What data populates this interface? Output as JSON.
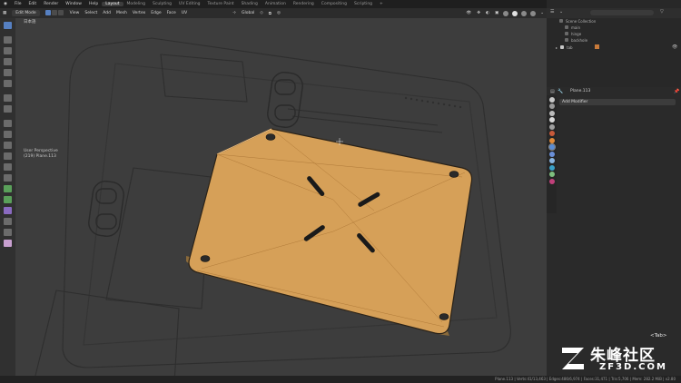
{
  "menu": {
    "items": [
      "File",
      "Edit",
      "Render",
      "Window",
      "Help"
    ],
    "workspaces": [
      "Layout",
      "Modeling",
      "Sculpting",
      "UV Editing",
      "Texture Paint",
      "Shading",
      "Animation",
      "Rendering",
      "Compositing",
      "Scripting"
    ],
    "active_workspace": "Layout",
    "add_tab": "+",
    "scene_label": "Scene",
    "view_layer_label": "View Layer"
  },
  "header": {
    "mode": "Edit Mode",
    "menus": [
      "View",
      "Select",
      "Add",
      "Mesh",
      "Vertex",
      "Edge",
      "Face",
      "UV"
    ],
    "orientation": "Global"
  },
  "viewport": {
    "ime_label": "日本語",
    "view_name": "User Perspective",
    "object_info": "(219) Plane.113"
  },
  "outliner": {
    "rows": [
      "Scene Collection",
      "main",
      "hinge",
      "backhole",
      "tab"
    ]
  },
  "properties": {
    "object_name": "Plane.113",
    "add_modifier": "Add Modifier",
    "tab_colors": [
      "#c9c9c9",
      "#9a9a9a",
      "#bcbcbc",
      "#d9d9d9",
      "#a0a0a0",
      "#c85a3a",
      "#e08a3a",
      "#5a8dd6",
      "#6a8fd8",
      "#8ab4e0",
      "#3aa0c8",
      "#7fbf7f",
      "#c0407a"
    ]
  },
  "overlay": {
    "key_hint": "<Tab>",
    "watermark_cn": "朱峰社区",
    "watermark_url": "ZF3D.COM"
  },
  "status": {
    "text": "Plane.113 | Verts:41/13,463 | Edges:486/6,974 | Faces:31,471 | Tris:5,706 | Mem: 282.2 MiB | v2.80"
  },
  "colors": {
    "selected_face": "#d6a058",
    "active_tool": "#5680c2",
    "viewport_bg": "#3d3d3d"
  }
}
